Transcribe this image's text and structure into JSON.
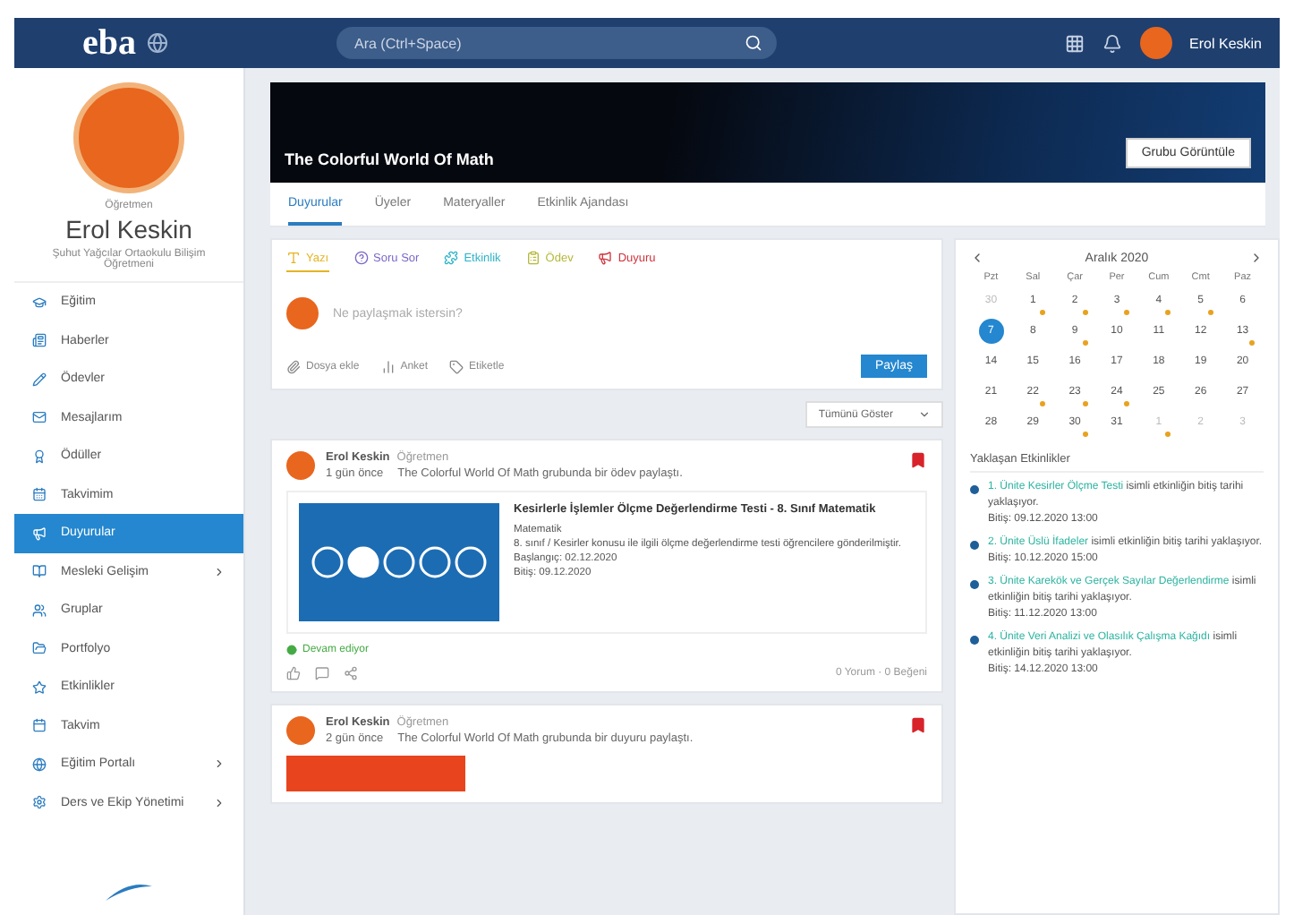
{
  "topbar": {
    "logo": "eba",
    "search": {
      "placeholder": "Ara (Ctrl+Space)"
    },
    "user": "Erol Keskin"
  },
  "profile": {
    "role": "Öğretmen",
    "name": "Erol Keskin",
    "school": "Şuhut Yağcılar Ortaokulu Bilişim Öğretmeni"
  },
  "sidebar": {
    "items": [
      {
        "label": "Eğitim",
        "selected": false,
        "expandable": false
      },
      {
        "label": "Haberler",
        "selected": false,
        "expandable": false
      },
      {
        "label": "Ödevler",
        "selected": false,
        "expandable": false
      },
      {
        "label": "Mesajlarım",
        "selected": false,
        "expandable": false
      },
      {
        "label": "Ödüller",
        "selected": false,
        "expandable": false
      },
      {
        "label": "Takvimim",
        "selected": false,
        "expandable": false
      },
      {
        "label": "Duyurular",
        "selected": true,
        "expandable": false
      },
      {
        "label": "Mesleki Gelişim",
        "selected": false,
        "expandable": true
      },
      {
        "label": "Gruplar",
        "selected": false,
        "expandable": false
      },
      {
        "label": "Portfolyo",
        "selected": false,
        "expandable": false
      },
      {
        "label": "Etkinlikler",
        "selected": false,
        "expandable": false
      },
      {
        "label": "Takvim",
        "selected": false,
        "expandable": false
      },
      {
        "label": "Eğitim Portalı",
        "selected": false,
        "expandable": true
      },
      {
        "label": "Ders ve Ekip Yönetimi",
        "selected": false,
        "expandable": true
      }
    ]
  },
  "banner": {
    "title": "The Colorful World Of Math",
    "button": "Grubu Görüntüle"
  },
  "tabs": [
    {
      "label": "Duyurular",
      "selected": true
    },
    {
      "label": "Üyeler",
      "selected": false
    },
    {
      "label": "Materyaller",
      "selected": false
    },
    {
      "label": "Etkinlik Ajandası",
      "selected": false
    }
  ],
  "composer": {
    "types": [
      {
        "label": "Yazı",
        "selected": true,
        "color": "#e6b422"
      },
      {
        "label": "Soru Sor",
        "selected": false,
        "color": "#7b68c8"
      },
      {
        "label": "Etkinlik",
        "selected": false,
        "color": "#2bb3c9"
      },
      {
        "label": "Ödev",
        "selected": false,
        "color": "#b5b83a"
      },
      {
        "label": "Duyuru",
        "selected": false,
        "color": "#d0343c"
      }
    ],
    "placeholder": "Ne paylaşmak istersin?",
    "actions": [
      "Dosya ekle",
      "Anket",
      "Etiketle"
    ],
    "submit": "Paylaş",
    "filter": "Tümünü Göster"
  },
  "posts": [
    {
      "author": "Erol Keskin",
      "role": "Öğretmen",
      "time": "1 gün önce",
      "text": "The Colorful World Of Math grubunda bir ödev paylaştı.",
      "pinned": true,
      "kind": "quiz",
      "title": "Kesirlerle İşlemler Ölçme Değerlendirme Testi - 8. Sınıf Matematik",
      "subject": "Matematik",
      "detail": "8. sınıf / Kesirler konusu ile ilgili ölçme değerlendirme testi öğrencilere gönderilmiştir.",
      "start": "Başlangıç: 02.12.2020",
      "end": "Bitiş: 09.12.2020",
      "status": "Devam ediyor",
      "stats": "0 Yorum · 0 Beğeni"
    },
    {
      "author": "Erol Keskin",
      "role": "Öğretmen",
      "time": "2 gün önce",
      "text": "The Colorful World Of Math grubunda bir duyuru paylaştı.",
      "pinned": true,
      "kind": "banner"
    }
  ],
  "calendar": {
    "title": "Aralık 2020",
    "weekdays": [
      "Pzt",
      "Sal",
      "Çar",
      "Per",
      "Cum",
      "Cmt",
      "Paz"
    ],
    "days": [
      {
        "d": "30",
        "outside": true,
        "selected": false,
        "event": false
      },
      {
        "d": "1",
        "outside": false,
        "selected": false,
        "event": true
      },
      {
        "d": "2",
        "outside": false,
        "selected": false,
        "event": true
      },
      {
        "d": "3",
        "outside": false,
        "selected": false,
        "event": true
      },
      {
        "d": "4",
        "outside": false,
        "selected": false,
        "event": true
      },
      {
        "d": "5",
        "outside": false,
        "selected": false,
        "event": true
      },
      {
        "d": "6",
        "outside": false,
        "selected": false,
        "event": false
      },
      {
        "d": "7",
        "outside": false,
        "selected": true,
        "event": false
      },
      {
        "d": "8",
        "outside": false,
        "selected": false,
        "event": false
      },
      {
        "d": "9",
        "outside": false,
        "selected": false,
        "event": true
      },
      {
        "d": "10",
        "outside": false,
        "selected": false,
        "event": false
      },
      {
        "d": "11",
        "outside": false,
        "selected": false,
        "event": false
      },
      {
        "d": "12",
        "outside": false,
        "selected": false,
        "event": false
      },
      {
        "d": "13",
        "outside": false,
        "selected": false,
        "event": true
      },
      {
        "d": "14",
        "outside": false,
        "selected": false,
        "event": false
      },
      {
        "d": "15",
        "outside": false,
        "selected": false,
        "event": false
      },
      {
        "d": "16",
        "outside": false,
        "selected": false,
        "event": false
      },
      {
        "d": "17",
        "outside": false,
        "selected": false,
        "event": false
      },
      {
        "d": "18",
        "outside": false,
        "selected": false,
        "event": false
      },
      {
        "d": "19",
        "outside": false,
        "selected": false,
        "event": false
      },
      {
        "d": "20",
        "outside": false,
        "selected": false,
        "event": false
      },
      {
        "d": "21",
        "outside": false,
        "selected": false,
        "event": false
      },
      {
        "d": "22",
        "outside": false,
        "selected": false,
        "event": true
      },
      {
        "d": "23",
        "outside": false,
        "selected": false,
        "event": true
      },
      {
        "d": "24",
        "outside": false,
        "selected": false,
        "event": true
      },
      {
        "d": "25",
        "outside": false,
        "selected": false,
        "event": false
      },
      {
        "d": "26",
        "outside": false,
        "selected": false,
        "event": false
      },
      {
        "d": "27",
        "outside": false,
        "selected": false,
        "event": false
      },
      {
        "d": "28",
        "outside": false,
        "selected": false,
        "event": false
      },
      {
        "d": "29",
        "outside": false,
        "selected": false,
        "event": false
      },
      {
        "d": "30",
        "outside": false,
        "selected": false,
        "event": true
      },
      {
        "d": "31",
        "outside": false,
        "selected": false,
        "event": false
      },
      {
        "d": "1",
        "outside": true,
        "selected": false,
        "event": true
      },
      {
        "d": "2",
        "outside": true,
        "selected": false,
        "event": false
      },
      {
        "d": "3",
        "outside": true,
        "selected": false,
        "event": false
      }
    ]
  },
  "upcoming": {
    "title": "Yaklaşan Etkinlikler",
    "items": [
      {
        "link": "1. Ünite Kesirler Ölçme Testi",
        "text": "isimli etkinliğin bitiş tarihi yaklaşıyor.",
        "date": "Bitiş: 09.12.2020 13:00"
      },
      {
        "link": "2. Ünite Üslü İfadeler",
        "text": "isimli etkinliğin bitiş tarihi yaklaşıyor.",
        "date": "Bitiş: 10.12.2020 15:00"
      },
      {
        "link": "3. Ünite Karekök ve Gerçek Sayılar Değerlendirme",
        "text": "isimli etkinliğin bitiş tarihi yaklaşıyor.",
        "date": "Bitiş: 11.12.2020 13:00"
      },
      {
        "link": "4. Ünite Veri Analizi ve Olasılık Çalışma Kağıdı",
        "text": "isimli etkinliğin bitiş tarihi yaklaşıyor.",
        "date": "Bitiş: 14.12.2020 13:00"
      }
    ]
  }
}
